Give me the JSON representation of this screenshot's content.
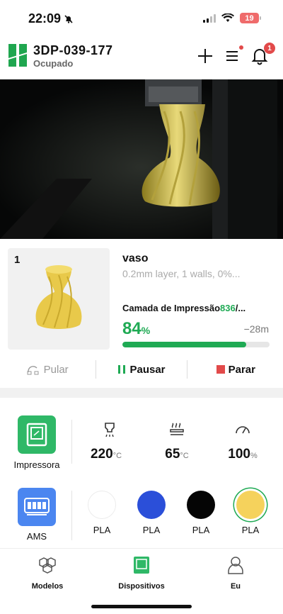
{
  "status_bar": {
    "time": "22:09",
    "battery": "19"
  },
  "header": {
    "title": "3DP-039-177",
    "status": "Ocupado",
    "notification_count": "1"
  },
  "job": {
    "plate": "1",
    "name": "vaso",
    "meta": "0.2mm layer, 1 walls, 0%...",
    "layer_label": "Camada de Impressão",
    "layer_value": "836",
    "layer_suffix": "/...",
    "percent_value": "84",
    "percent_sign": "%",
    "remaining": "−28m",
    "progress": 0.84
  },
  "actions": {
    "skip": "Pular",
    "pause": "Pausar",
    "stop": "Parar"
  },
  "printer": {
    "label": "Impressora",
    "nozzle_temp": "220",
    "nozzle_unit": "°C",
    "bed_temp": "65",
    "bed_unit": "°C",
    "speed": "100",
    "speed_unit": "%"
  },
  "ams": {
    "label": "AMS",
    "spools": [
      {
        "material": "PLA",
        "color": "#ffffff"
      },
      {
        "material": "PLA",
        "color": "#2b4fd9"
      },
      {
        "material": "PLA",
        "color": "#050505"
      },
      {
        "material": "PLA",
        "color": "#f5d25c"
      }
    ]
  },
  "nav": {
    "models": "Modelos",
    "devices": "Dispositivos",
    "me": "Eu"
  },
  "colors": {
    "accent": "#1faa54",
    "danger": "#e24a4a",
    "device_tile": "#2fb867",
    "ams_tile": "#4b86f0"
  }
}
